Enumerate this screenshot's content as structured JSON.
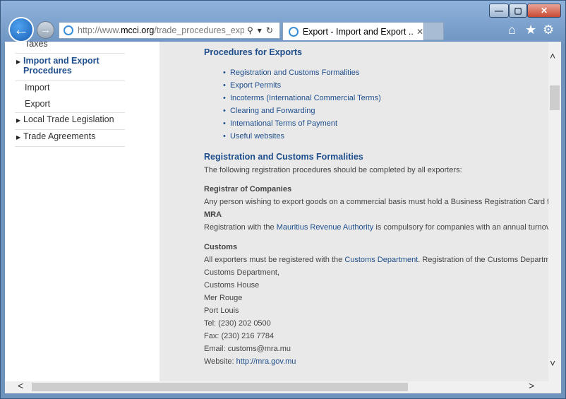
{
  "browser": {
    "url_prefix": "http://www.",
    "url_domain": "mcci.org",
    "url_rest": "/trade_procedures_expo",
    "tab_title": "Export - Import and Export ...",
    "window_controls": {
      "minimize": "—",
      "maximize": "▢",
      "close": "✕"
    },
    "icons": {
      "back": "back-arrow-icon",
      "forward": "forward-arrow-icon",
      "search": "search-icon",
      "refresh": "refresh-icon",
      "home": "home-icon",
      "favorites": "star-icon",
      "tools": "gear-icon"
    }
  },
  "sidebar": {
    "items": [
      {
        "label": "Taxes"
      },
      {
        "label": "Import and Export Procedures"
      },
      {
        "label": "Import"
      },
      {
        "label": "Export"
      },
      {
        "label": "Local Trade Legislation"
      },
      {
        "label": "Trade Agreements"
      }
    ]
  },
  "content": {
    "procedures_title": "Procedures for Exports",
    "procedures_links": [
      "Registration and Customs Formalities",
      "Export Permits",
      "Incoterms (International Commercial Terms)",
      "Clearing and Forwarding",
      "International Terms of Payment",
      "Useful websites"
    ],
    "reg_title": "Registration and Customs Formalities",
    "reg_intro": "The following registration procedures should be completed by all exporters:",
    "registrar_title": "Registrar of Companies",
    "registrar_text": "Any person wishing to export goods on a commercial basis must hold a Business Registration Card f",
    "mra_title": "MRA",
    "mra_pre": "Registration with the ",
    "mra_link": "Mauritius Revenue Authority",
    "mra_post": " is compulsory for companies with an annual turnov",
    "customs_title": "Customs",
    "customs_pre": "All exporters must be registered with the ",
    "customs_link": "Customs Department",
    "customs_post": ". Registration of the Customs Departm",
    "address": [
      "Customs Department,",
      "Customs House",
      "Mer Rouge",
      "Port Louis",
      "Tel: (230) 202 0500",
      "Fax: (230) 216 7784",
      "Email: customs@mra.mu"
    ],
    "website_label": "Website: ",
    "website_link": "http://mra.gov.mu"
  },
  "colors": {
    "link": "#1f4e8c",
    "content_bg": "#e9e9e9",
    "chrome": "#6f95c2"
  }
}
